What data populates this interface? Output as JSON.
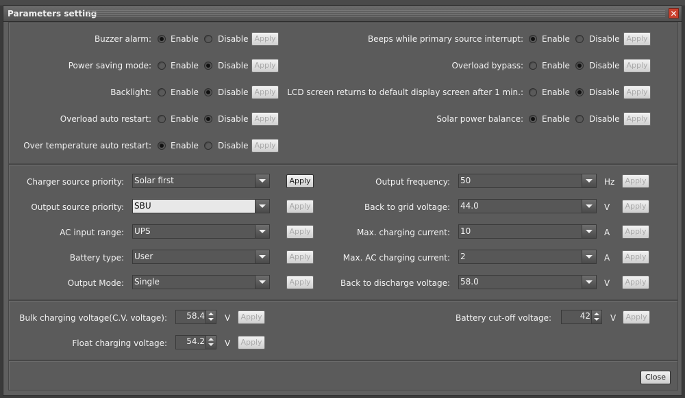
{
  "window": {
    "title": "Parameters setting",
    "close_label": "Close"
  },
  "radio": {
    "enable": "Enable",
    "disable": "Disable",
    "apply": "Apply"
  },
  "radio_settings_left": [
    {
      "label": "Buzzer alarm:",
      "selected": "Enable"
    },
    {
      "label": "Power saving mode:",
      "selected": "Disable"
    },
    {
      "label": "Backlight:",
      "selected": "Disable"
    },
    {
      "label": "Overload auto restart:",
      "selected": "Disable"
    },
    {
      "label": "Over temperature auto restart:",
      "selected": "Enable"
    }
  ],
  "radio_settings_right": [
    {
      "label": "Beeps while primary source interrupt:",
      "selected": "Enable"
    },
    {
      "label": "Overload bypass:",
      "selected": "Disable"
    },
    {
      "label": "LCD screen returns to default display screen after 1 min.:",
      "selected": "Disable"
    },
    {
      "label": "Solar power balance:",
      "selected": "Enable"
    }
  ],
  "dropdowns_left": [
    {
      "label": "Charger source priority:",
      "value": "Solar first",
      "apply_active": true
    },
    {
      "label": "Output source priority:",
      "value": "SBU",
      "apply_active": false
    },
    {
      "label": "AC input range:",
      "value": "UPS",
      "apply_active": false
    },
    {
      "label": "Battery type:",
      "value": "User",
      "apply_active": false
    },
    {
      "label": "Output Mode:",
      "value": "Single",
      "apply_active": false
    }
  ],
  "dropdowns_right": [
    {
      "label": "Output frequency:",
      "value": "50",
      "unit": "Hz"
    },
    {
      "label": "Back to grid voltage:",
      "value": "44.0",
      "unit": "V"
    },
    {
      "label": "Max. charging current:",
      "value": "10",
      "unit": "A"
    },
    {
      "label": "Max. AC charging current:",
      "value": "2",
      "unit": "A"
    },
    {
      "label": "Back to discharge voltage:",
      "value": "58.0",
      "unit": "V"
    }
  ],
  "voltages": {
    "bulk": {
      "label": "Bulk charging voltage(C.V. voltage):",
      "value": "58.4",
      "unit": "V"
    },
    "float": {
      "label": "Float charging voltage:",
      "value": "54.2",
      "unit": "V"
    },
    "cutoff": {
      "label": "Battery cut-off voltage:",
      "value": "42",
      "unit": "V"
    }
  },
  "icons": {
    "close": "close-icon",
    "dropdown": "chevron-down-icon",
    "spinner": "spinner-arrows-icon"
  }
}
